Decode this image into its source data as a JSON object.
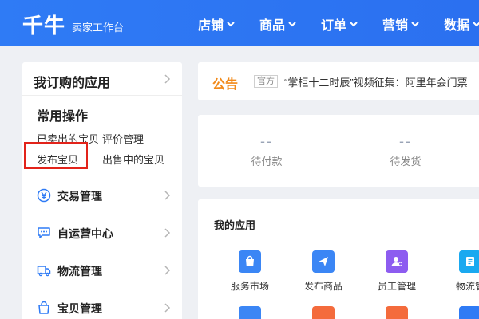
{
  "topbar": {
    "logo": "千牛",
    "subtitle": "卖家工作台",
    "nav": [
      {
        "label": "店铺"
      },
      {
        "label": "商品"
      },
      {
        "label": "订单"
      },
      {
        "label": "营销"
      },
      {
        "label": "数据"
      }
    ]
  },
  "left_panel": {
    "title": "我订购的应用",
    "common_title": "常用操作",
    "common_links": [
      "已卖出的宝贝",
      "评价管理",
      "发布宝贝",
      "出售中的宝贝"
    ],
    "menu": [
      {
        "label": "交易管理",
        "icon": "yen-circle-icon"
      },
      {
        "label": "自运营中心",
        "icon": "chat-icon"
      },
      {
        "label": "物流管理",
        "icon": "truck-icon"
      },
      {
        "label": "宝贝管理",
        "icon": "bag-icon"
      }
    ]
  },
  "notice": {
    "label": "公告",
    "tag": "官方",
    "text": "“掌柜十二时辰”视频征集：阿里年会门票"
  },
  "stats": [
    {
      "value": "--",
      "label": "待付款"
    },
    {
      "value": "--",
      "label": "待发货"
    }
  ],
  "apps": {
    "title": "我的应用",
    "items": [
      {
        "label": "服务市场",
        "icon": "shopping-bag-icon",
        "color": "#3b86f5"
      },
      {
        "label": "发布商品",
        "icon": "send-icon",
        "color": "#3b86f5"
      },
      {
        "label": "员工管理",
        "icon": "user-icon",
        "color": "#8d5cf0"
      },
      {
        "label": "物流管",
        "icon": "logistics-icon",
        "color": "#1aa9f0"
      }
    ]
  },
  "colors": {
    "brand_blue": "#2f7bf5",
    "notice_orange": "#f28a1a",
    "highlight_red": "#e2231a"
  }
}
